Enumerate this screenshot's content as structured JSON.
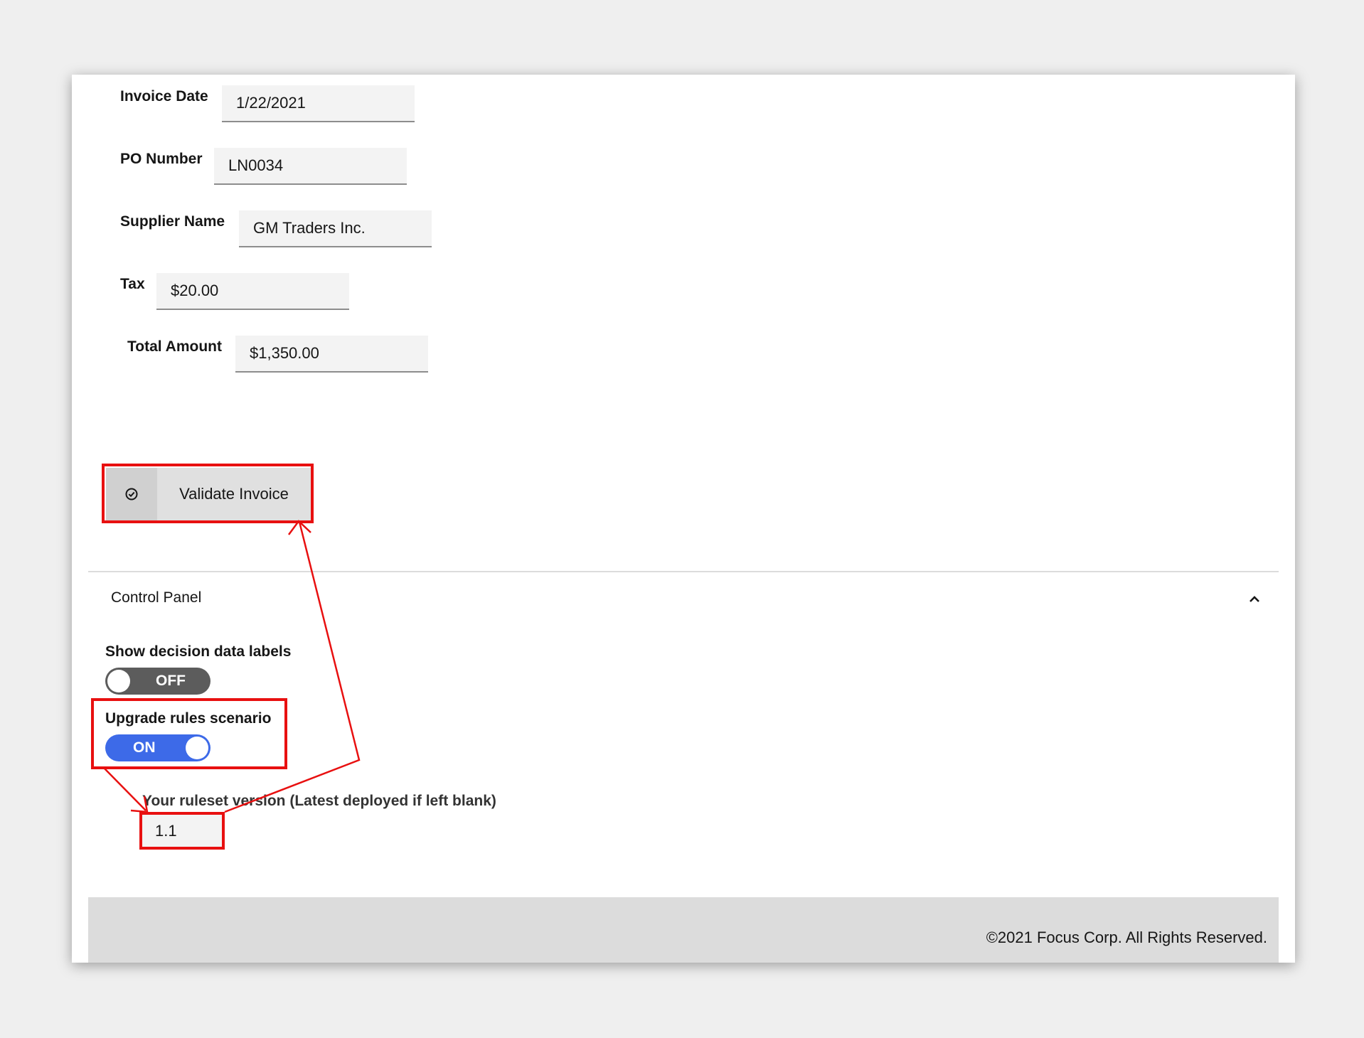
{
  "form": {
    "invoice_date": {
      "label": "Invoice Date",
      "value": "1/22/2021"
    },
    "po_number": {
      "label": "PO Number",
      "value": "LN0034"
    },
    "supplier_name": {
      "label": "Supplier Name",
      "value": "GM Traders Inc."
    },
    "tax": {
      "label": "Tax",
      "value": "$20.00"
    },
    "total_amount": {
      "label": "Total Amount",
      "value": "$1,350.00"
    }
  },
  "validate_button": {
    "label": "Validate Invoice",
    "icon": "check-circle-icon"
  },
  "control_panel": {
    "title": "Control Panel",
    "collapse_icon": "chevron-up-icon",
    "show_labels": {
      "label": "Show decision data labels",
      "state": "OFF"
    },
    "upgrade_rules": {
      "label": "Upgrade rules scenario",
      "state": "ON"
    },
    "ruleset": {
      "label": "Your ruleset version (Latest deployed if left blank)",
      "value": "1.1"
    }
  },
  "footer": {
    "text": "©2021 Focus Corp. All Rights Reserved."
  },
  "colors": {
    "annotation": "#e81010",
    "toggle_on": "#3d6ae8",
    "toggle_off": "#5c5c5c"
  }
}
